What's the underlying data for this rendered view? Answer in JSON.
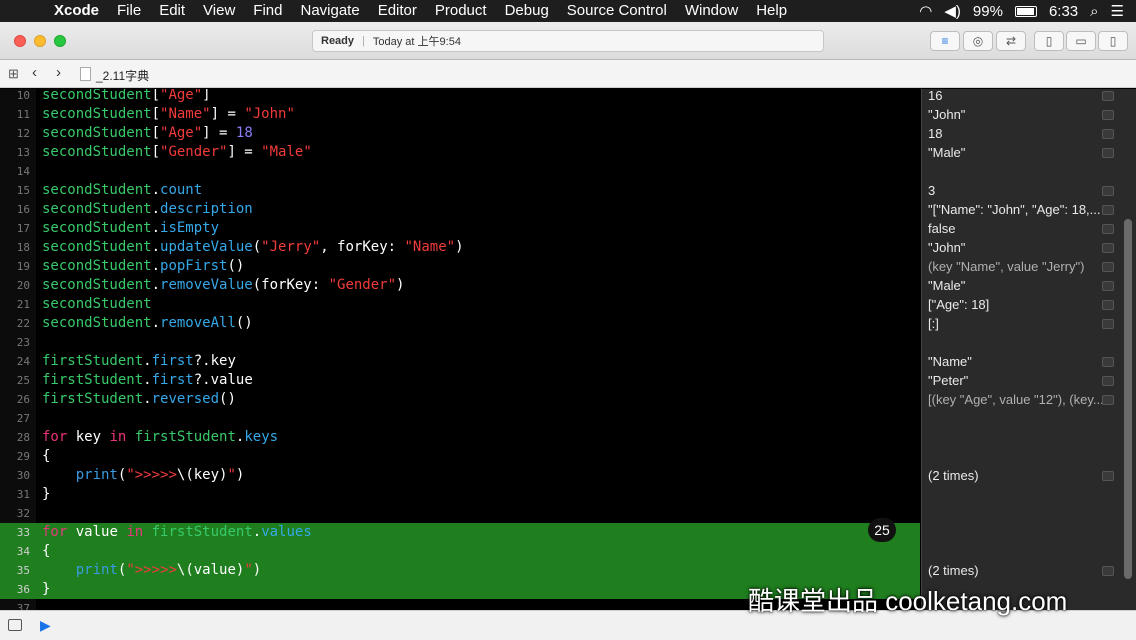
{
  "menubar": {
    "apple": "",
    "items": [
      "Xcode",
      "File",
      "Edit",
      "View",
      "Find",
      "Navigate",
      "Editor",
      "Product",
      "Debug",
      "Source Control",
      "Window",
      "Help"
    ],
    "battery": "99%",
    "clock": "6:33"
  },
  "toolbar": {
    "status_ready": "Ready",
    "status_time": "Today at 上午9:54"
  },
  "jumpbar": {
    "file_name": "_2.11字典"
  },
  "editor": {
    "badge": "25",
    "lines": [
      {
        "n": "10",
        "tokens": [
          [
            "var",
            "secondStudent"
          ],
          [
            "plain",
            "["
          ],
          [
            "str",
            "\"Age\""
          ],
          [
            "plain",
            "]"
          ]
        ]
      },
      {
        "n": "11",
        "tokens": [
          [
            "var",
            "secondStudent"
          ],
          [
            "plain",
            "["
          ],
          [
            "str",
            "\"Name\""
          ],
          [
            "plain",
            "] = "
          ],
          [
            "str",
            "\"John\""
          ]
        ]
      },
      {
        "n": "12",
        "tokens": [
          [
            "var",
            "secondStudent"
          ],
          [
            "plain",
            "["
          ],
          [
            "str",
            "\"Age\""
          ],
          [
            "plain",
            "] = "
          ],
          [
            "num",
            "18"
          ]
        ]
      },
      {
        "n": "13",
        "tokens": [
          [
            "var",
            "secondStudent"
          ],
          [
            "plain",
            "["
          ],
          [
            "str",
            "\"Gender\""
          ],
          [
            "plain",
            "] = "
          ],
          [
            "str",
            "\"Male\""
          ]
        ]
      },
      {
        "n": "14",
        "tokens": []
      },
      {
        "n": "15",
        "tokens": [
          [
            "var",
            "secondStudent"
          ],
          [
            "plain",
            "."
          ],
          [
            "prop",
            "count"
          ]
        ]
      },
      {
        "n": "16",
        "tokens": [
          [
            "var",
            "secondStudent"
          ],
          [
            "plain",
            "."
          ],
          [
            "prop",
            "description"
          ]
        ]
      },
      {
        "n": "17",
        "tokens": [
          [
            "var",
            "secondStudent"
          ],
          [
            "plain",
            "."
          ],
          [
            "prop",
            "isEmpty"
          ]
        ]
      },
      {
        "n": "18",
        "tokens": [
          [
            "var",
            "secondStudent"
          ],
          [
            "plain",
            "."
          ],
          [
            "prop",
            "updateValue"
          ],
          [
            "plain",
            "("
          ],
          [
            "str",
            "\"Jerry\""
          ],
          [
            "plain",
            ", forKey: "
          ],
          [
            "str",
            "\"Name\""
          ],
          [
            "plain",
            ")"
          ]
        ]
      },
      {
        "n": "19",
        "tokens": [
          [
            "var",
            "secondStudent"
          ],
          [
            "plain",
            "."
          ],
          [
            "prop",
            "popFirst"
          ],
          [
            "plain",
            "()"
          ]
        ]
      },
      {
        "n": "20",
        "tokens": [
          [
            "var",
            "secondStudent"
          ],
          [
            "plain",
            "."
          ],
          [
            "prop",
            "removeValue"
          ],
          [
            "plain",
            "(forKey: "
          ],
          [
            "str",
            "\"Gender\""
          ],
          [
            "plain",
            ")"
          ]
        ]
      },
      {
        "n": "21",
        "tokens": [
          [
            "var",
            "secondStudent"
          ]
        ]
      },
      {
        "n": "22",
        "tokens": [
          [
            "var",
            "secondStudent"
          ],
          [
            "plain",
            "."
          ],
          [
            "prop",
            "removeAll"
          ],
          [
            "plain",
            "()"
          ]
        ]
      },
      {
        "n": "23",
        "tokens": []
      },
      {
        "n": "24",
        "tokens": [
          [
            "var",
            "firstStudent"
          ],
          [
            "plain",
            "."
          ],
          [
            "prop",
            "first"
          ],
          [
            "plain",
            "?.key"
          ]
        ]
      },
      {
        "n": "25",
        "tokens": [
          [
            "var",
            "firstStudent"
          ],
          [
            "plain",
            "."
          ],
          [
            "prop",
            "first"
          ],
          [
            "plain",
            "?.value"
          ]
        ]
      },
      {
        "n": "26",
        "tokens": [
          [
            "var",
            "firstStudent"
          ],
          [
            "plain",
            "."
          ],
          [
            "prop",
            "reversed"
          ],
          [
            "plain",
            "()"
          ]
        ]
      },
      {
        "n": "27",
        "tokens": []
      },
      {
        "n": "28",
        "tokens": [
          [
            "kw",
            "for"
          ],
          [
            "plain",
            " key "
          ],
          [
            "kw",
            "in"
          ],
          [
            "plain",
            " "
          ],
          [
            "var",
            "firstStudent"
          ],
          [
            "plain",
            "."
          ],
          [
            "prop",
            "keys"
          ]
        ]
      },
      {
        "n": "29",
        "tokens": [
          [
            "plain",
            "{"
          ]
        ]
      },
      {
        "n": "30",
        "tokens": [
          [
            "plain",
            "    "
          ],
          [
            "func",
            "print"
          ],
          [
            "plain",
            "("
          ],
          [
            "str",
            "\">>>>>"
          ],
          [
            "plain",
            "\\(key)"
          ],
          [
            "str",
            "\""
          ],
          [
            "plain",
            ")"
          ]
        ]
      },
      {
        "n": "31",
        "tokens": [
          [
            "plain",
            "}"
          ]
        ]
      },
      {
        "n": "32",
        "tokens": []
      },
      {
        "n": "33",
        "hl": true,
        "tokens": [
          [
            "kw",
            "for"
          ],
          [
            "plain",
            " value "
          ],
          [
            "kw",
            "in"
          ],
          [
            "plain",
            " "
          ],
          [
            "var",
            "firstStudent"
          ],
          [
            "plain",
            "."
          ],
          [
            "prop",
            "values"
          ]
        ]
      },
      {
        "n": "34",
        "hl": true,
        "tokens": [
          [
            "plain",
            "{"
          ]
        ]
      },
      {
        "n": "35",
        "hl": true,
        "tokens": [
          [
            "plain",
            "    "
          ],
          [
            "func",
            "print"
          ],
          [
            "plain",
            "("
          ],
          [
            "str",
            "\">>>>>"
          ],
          [
            "plain",
            "\\(value)"
          ],
          [
            "str",
            "\""
          ],
          [
            "plain",
            ")"
          ]
        ]
      },
      {
        "n": "36",
        "hl": true,
        "tokens": [
          [
            "plain",
            "}"
          ]
        ]
      },
      {
        "n": "37",
        "tokens": []
      }
    ]
  },
  "results": [
    {
      "line": 0,
      "text": "16"
    },
    {
      "line": 1,
      "text": "\"John\""
    },
    {
      "line": 2,
      "text": "18"
    },
    {
      "line": 3,
      "text": "\"Male\""
    },
    {
      "line": 5,
      "text": "3"
    },
    {
      "line": 6,
      "text": "\"[\"Name\": \"John\", \"Age\": 18,..."
    },
    {
      "line": 7,
      "text": "false"
    },
    {
      "line": 8,
      "text": "\"John\""
    },
    {
      "line": 9,
      "text": "(key \"Name\", value \"Jerry\")",
      "dim": true
    },
    {
      "line": 10,
      "text": "\"Male\""
    },
    {
      "line": 11,
      "text": "[\"Age\": 18]"
    },
    {
      "line": 12,
      "text": "[:]"
    },
    {
      "line": 14,
      "text": "\"Name\""
    },
    {
      "line": 15,
      "text": "\"Peter\""
    },
    {
      "line": 16,
      "text": "[(key \"Age\", value \"12\"), (key...",
      "dim": true
    },
    {
      "line": 20,
      "text": "(2 times)"
    },
    {
      "line": 25,
      "text": "(2 times)"
    }
  ],
  "watermark": "酷课堂出品 coolketang.com"
}
